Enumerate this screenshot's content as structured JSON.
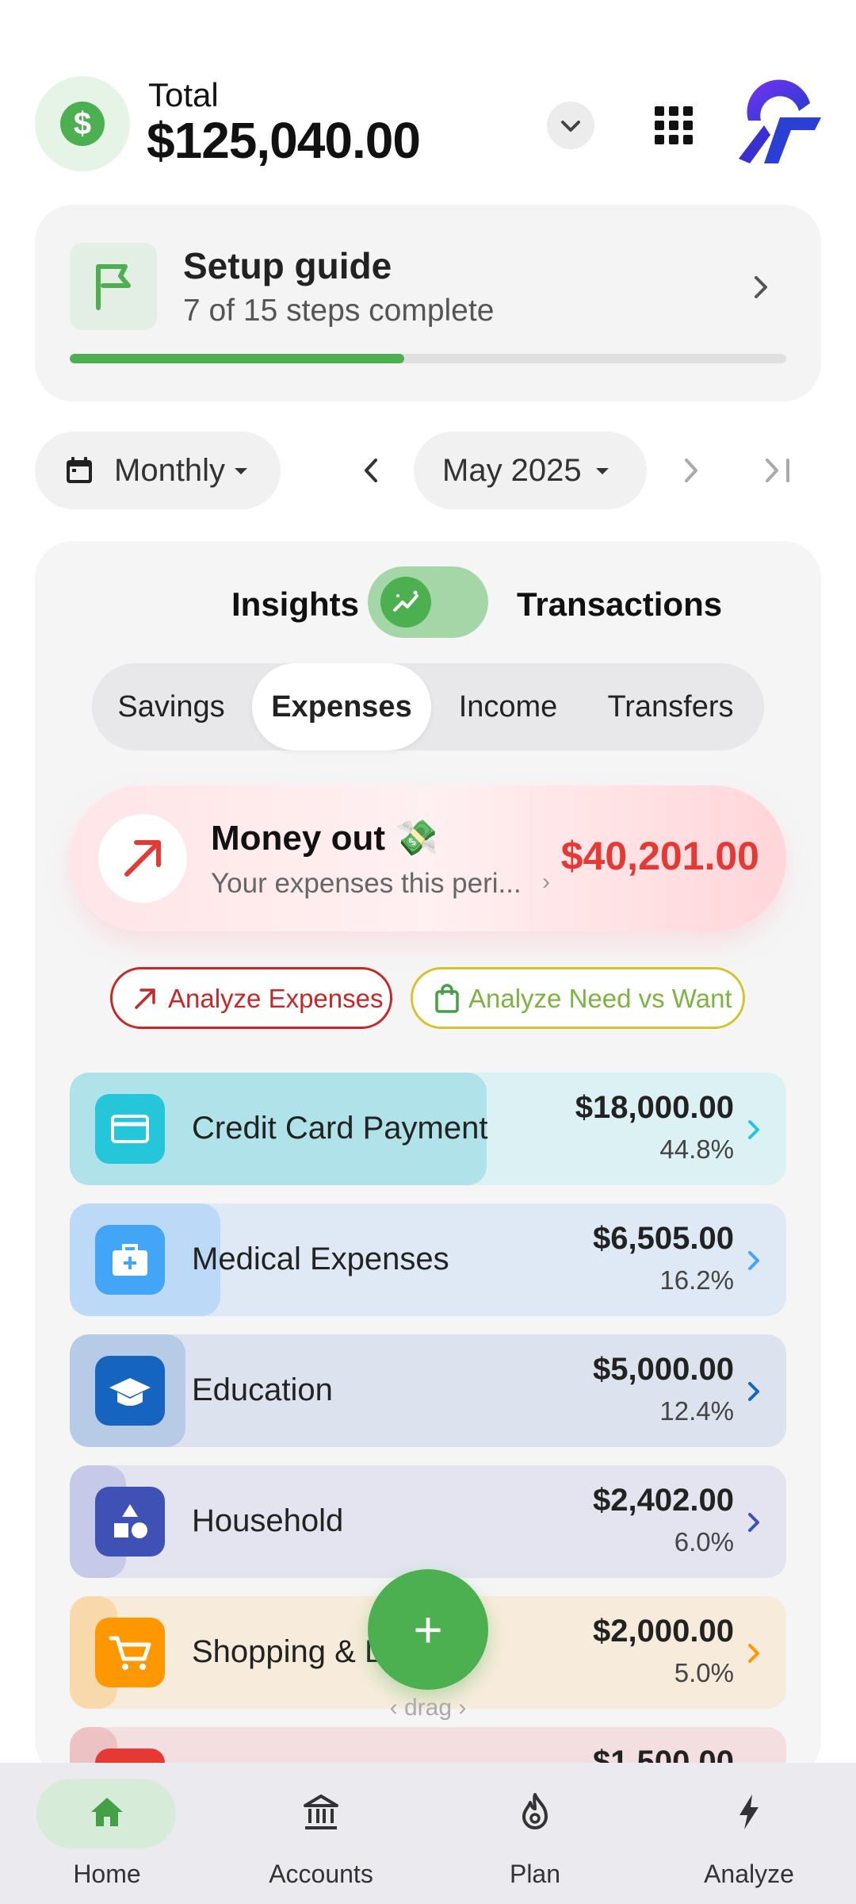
{
  "header": {
    "total_label": "Total",
    "total_value": "$125,040.00",
    "currency_symbol": "$"
  },
  "setup_guide": {
    "title": "Setup guide",
    "subtitle": "7 of 15 steps complete",
    "steps_done": 7,
    "steps_total": 15
  },
  "period": {
    "frequency": "Monthly",
    "month": "May 2025"
  },
  "view_toggle": {
    "left": "Insights",
    "right": "Transactions"
  },
  "segments": [
    "Savings",
    "Expenses",
    "Income",
    "Transfers"
  ],
  "money_out": {
    "title": "Money out",
    "emoji": "💸",
    "subtitle": "Your expenses this peri...",
    "value": "$40,201.00"
  },
  "analyze": {
    "expenses": "Analyze Expenses",
    "need_vs_want": "Analyze Need vs Want"
  },
  "categories": [
    {
      "label": "Credit Card Payment",
      "amount": "$18,000.00",
      "percent": "44.8%",
      "share": 0.448,
      "color": "#26c6da"
    },
    {
      "label": "Medical Expenses",
      "amount": "$6,505.00",
      "percent": "16.2%",
      "share": 0.162,
      "color": "#42a5f5"
    },
    {
      "label": "Education",
      "amount": "$5,000.00",
      "percent": "12.4%",
      "share": 0.124,
      "color": "#1565c0"
    },
    {
      "label": "Household",
      "amount": "$2,402.00",
      "percent": "6.0%",
      "share": 0.06,
      "color": "#3f51b5"
    },
    {
      "label": "Shopping & Leisure",
      "amount": "$2,000.00",
      "percent": "5.0%",
      "share": 0.05,
      "color": "#ff9800"
    },
    {
      "label": "",
      "amount": "$1,500.00",
      "percent": "",
      "share": 0.037,
      "color": "#e53935"
    }
  ],
  "fab": {
    "label": "+",
    "drag_hint": "drag"
  },
  "bottom_nav": [
    {
      "label": "Home",
      "icon": "home-icon"
    },
    {
      "label": "Accounts",
      "icon": "bank-icon"
    },
    {
      "label": "Plan",
      "icon": "flame-icon"
    },
    {
      "label": "Analyze",
      "icon": "bolt-icon"
    }
  ],
  "colors": {
    "accent": "#4caf50",
    "expense_red": "#e53935"
  }
}
